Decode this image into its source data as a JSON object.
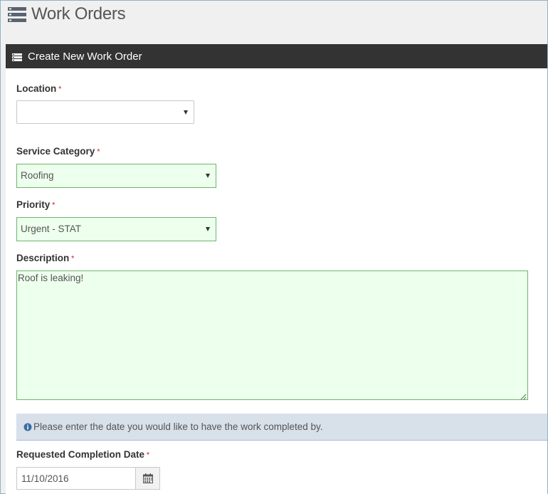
{
  "page": {
    "title": "Work Orders",
    "icon": "list-icon"
  },
  "panel": {
    "title": "Create New Work Order",
    "icon": "list-icon"
  },
  "form": {
    "required_marker": "*",
    "location": {
      "label": "Location",
      "value": ""
    },
    "service_category": {
      "label": "Service Category",
      "value": "Roofing"
    },
    "priority": {
      "label": "Priority",
      "value": "Urgent - STAT"
    },
    "description": {
      "label": "Description",
      "value": "Roof is leaking!"
    },
    "info_message": "Please enter the date you would like to have the work completed by.",
    "info_icon": "info-circle-icon",
    "completion_date": {
      "label": "Requested Completion Date",
      "value": "11/10/2016",
      "button_icon": "calendar-icon"
    }
  },
  "colors": {
    "header_bar": "#333333",
    "valid_bg": "#edffed",
    "valid_border": "#6cb56c",
    "required": "#d9534f",
    "info_bg": "#d8e0ea"
  }
}
